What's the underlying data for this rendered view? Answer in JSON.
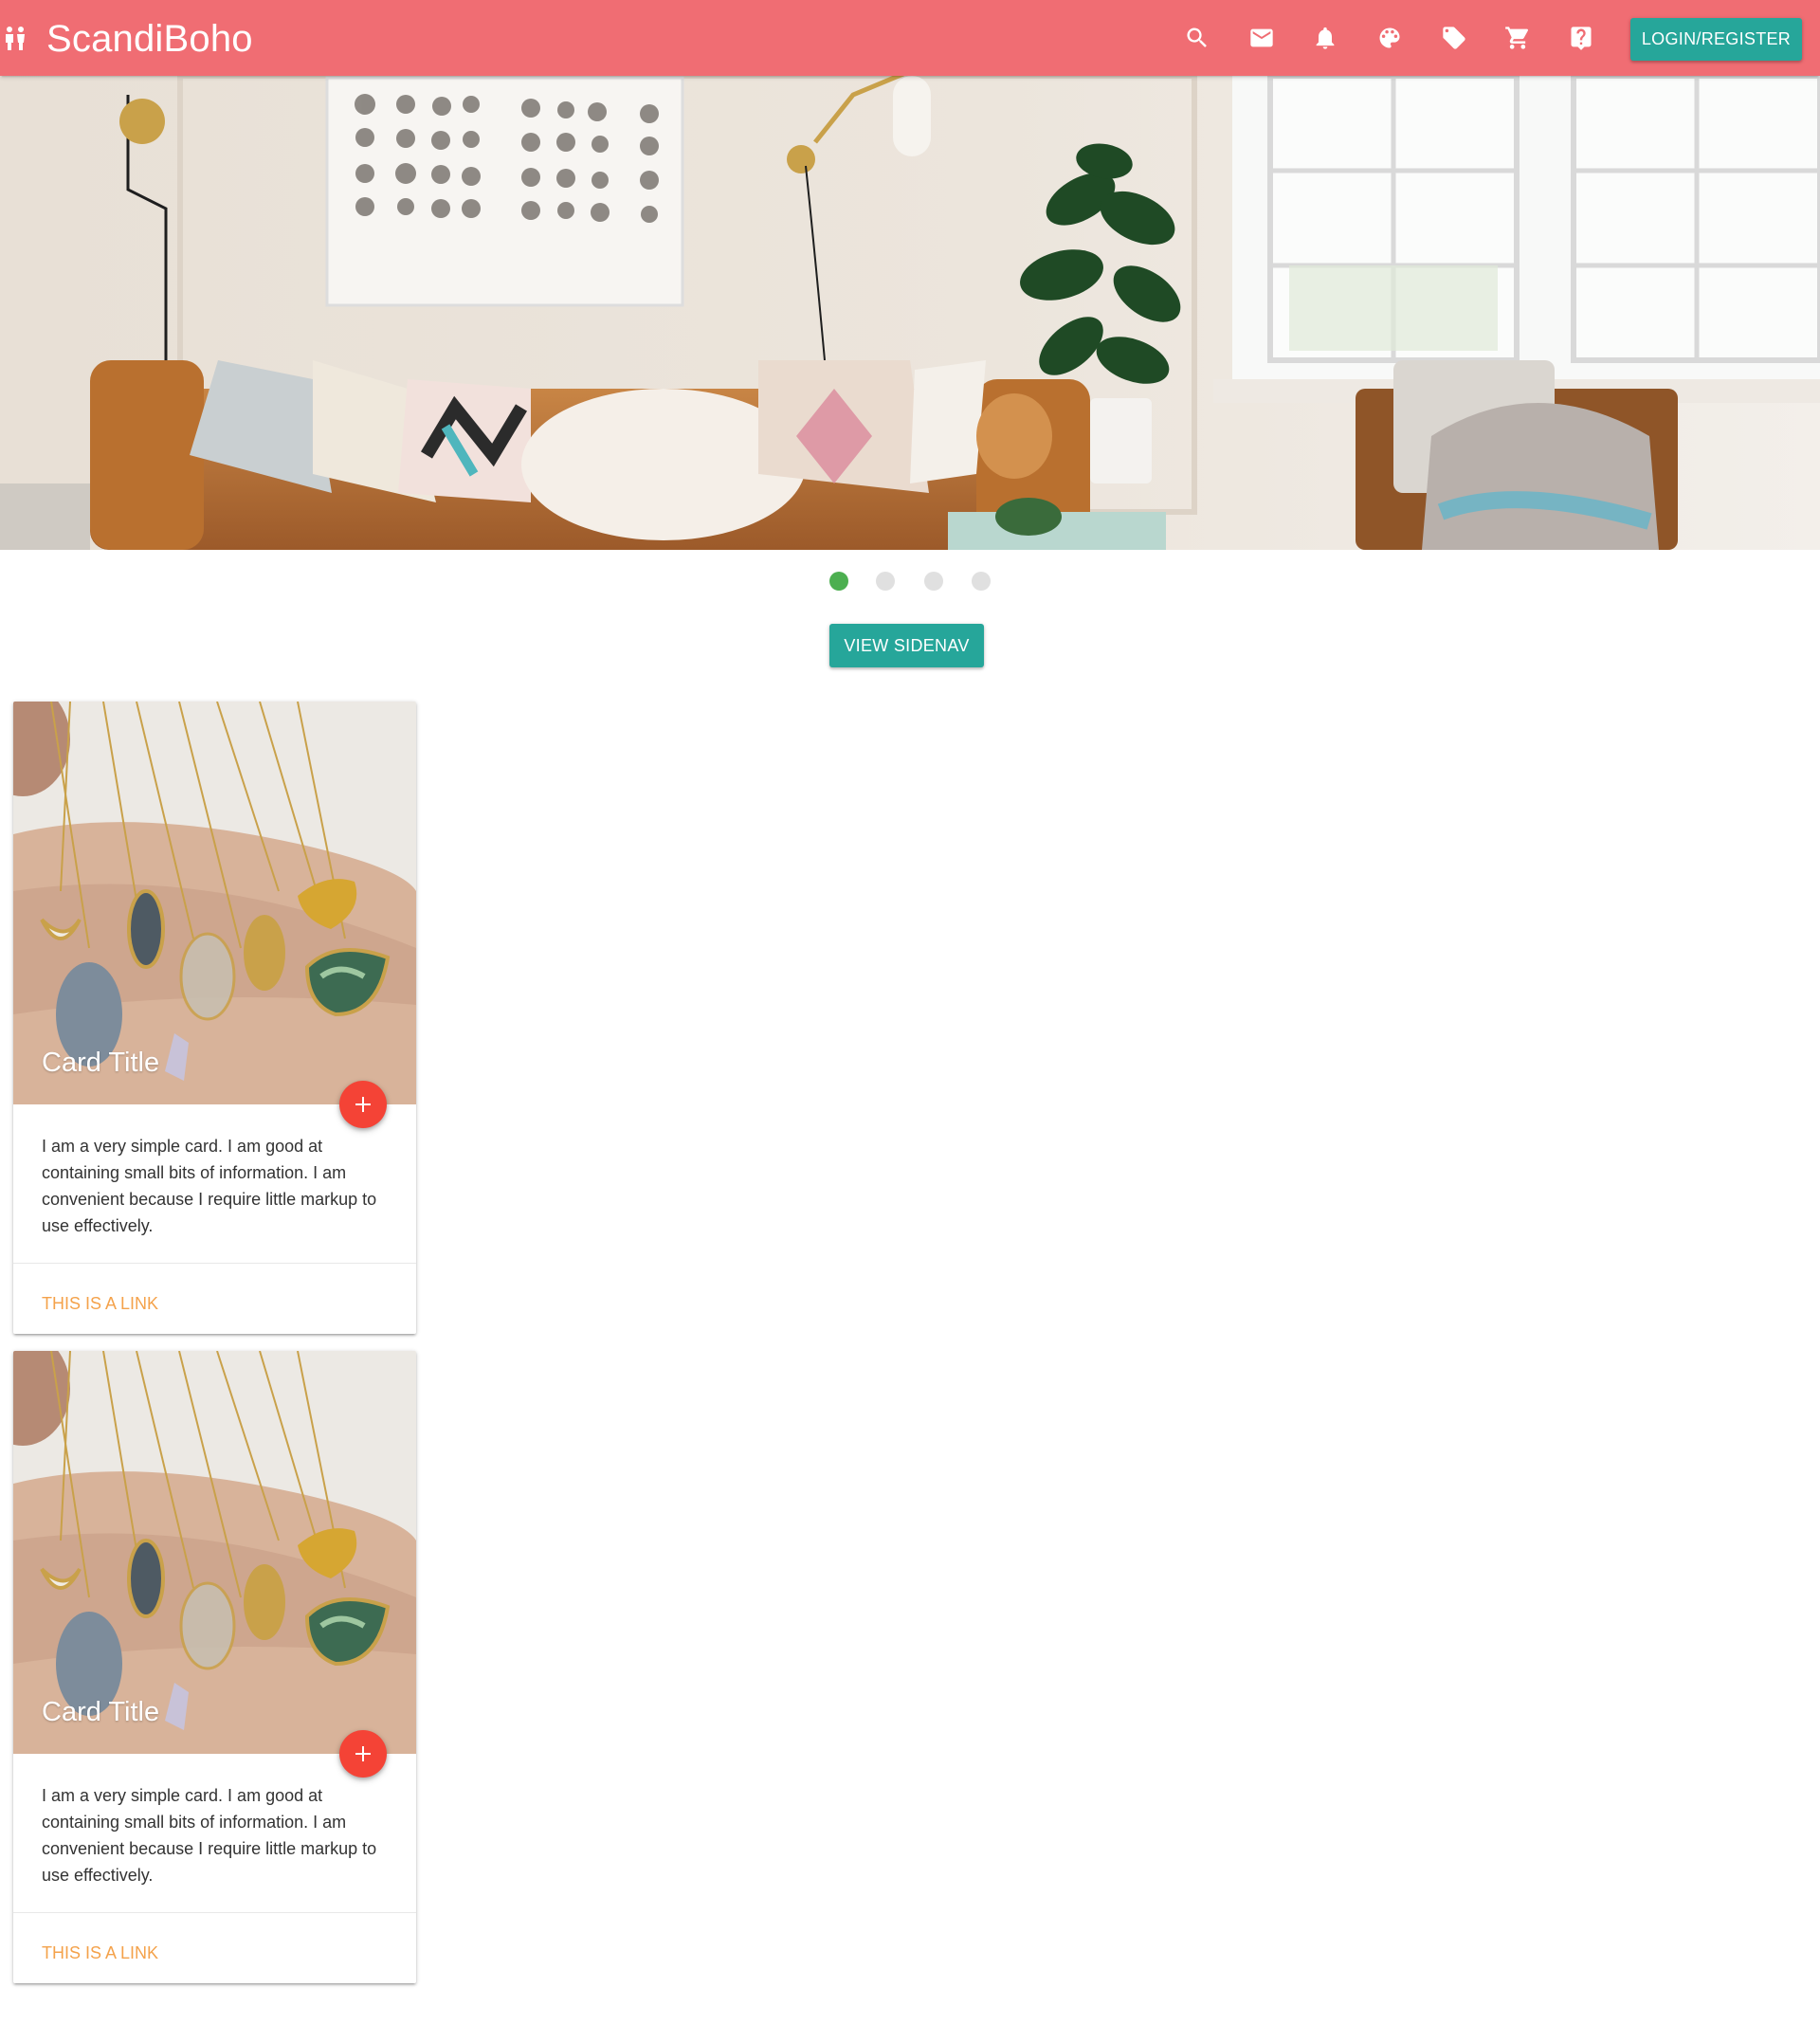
{
  "navbar": {
    "brand_icon": "people-icon",
    "brand_title": "ScandiBoho",
    "background_color": "#f06d73",
    "icons": [
      "search-icon",
      "mail-icon",
      "bell-icon",
      "palette-icon",
      "tag-icon",
      "cart-icon",
      "help-icon"
    ],
    "login_label": "LOGIN/REGISTER",
    "login_color": "#26a69a"
  },
  "carousel": {
    "slide_count": 4,
    "active_index": 0,
    "active_color": "#4caf50",
    "inactive_color": "#e0e0e0"
  },
  "sidenav_button": {
    "label": "VIEW SIDENAV"
  },
  "cards": [
    {
      "title": "Card Title",
      "content": "I am a very simple card. I am good at containing small bits of information. I am convenient because I require little markup to use effectively.",
      "link": "THIS IS A LINK",
      "fab_icon": "add-icon"
    },
    {
      "title": "Card Title",
      "content": "I am a very simple card. I am good at containing small bits of information. I am convenient because I require little markup to use effectively.",
      "link": "THIS IS A LINK",
      "fab_icon": "add-icon"
    }
  ],
  "colors": {
    "accent": "#26a69a",
    "fab": "#f44336",
    "link": "#f4a24b"
  }
}
